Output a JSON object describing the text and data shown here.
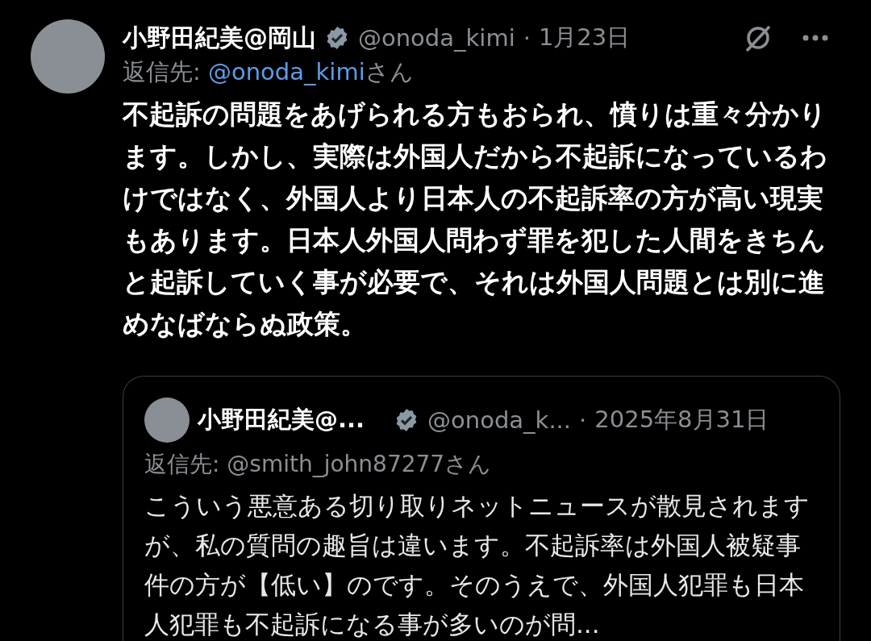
{
  "post": {
    "author": "小野田紀美@岡山",
    "verified": true,
    "handle": "@onoda_kimi",
    "separator": "·",
    "date": "1月23日",
    "reply_label": "返信先:",
    "reply_handle": "@onoda_kimi",
    "reply_suffix": "さん",
    "text": "不起訴の問題をあげられる方もおられ、憤りは重々分かります。しかし、実際は外国人だから不起訴になっているわけではなく、外国人より日本人の不起訴率の方が高い現実もあります。日本人外国人問わず罪を犯した人間をきちんと起訴していく事が必要で、それは外国人問題とは別に進めなばならぬ政策。",
    "quote": {
      "author": "小野田紀美@...",
      "verified": true,
      "handle": "@onoda_k...",
      "separator": "·",
      "date": "2025年8月31日",
      "reply_label": "返信先:",
      "reply_handle": "@smith_john87277",
      "reply_suffix": "さん",
      "text": "こういう悪意ある切り取りネットニュースが散見されますが、私の質問の趣旨は違います。不起訴率は外国人被疑事件の方が【低い】のです。そのうえで、外国人犯罪も日本人犯罪も不起訴になる事が多いのが問..."
    }
  }
}
